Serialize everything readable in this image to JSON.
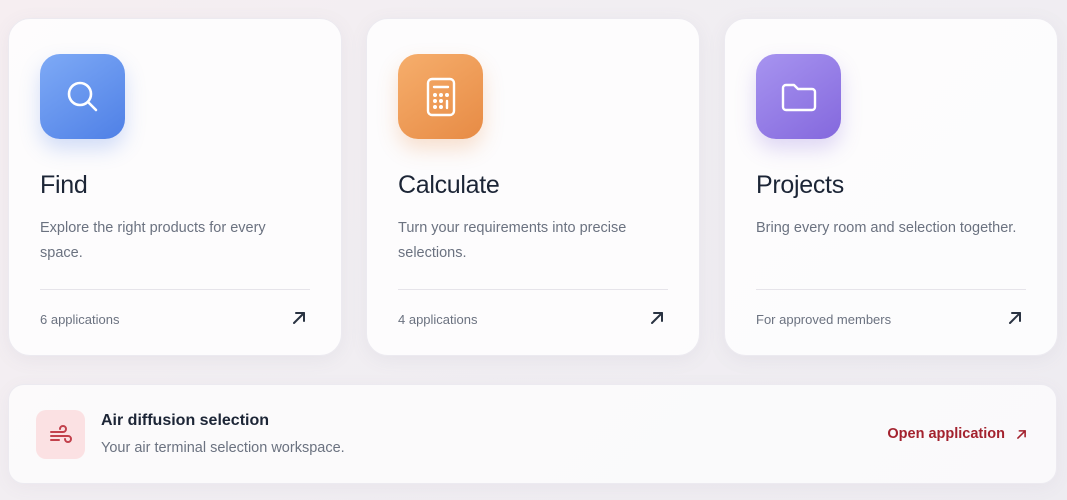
{
  "cards": [
    {
      "title": "Find",
      "description": "Explore the right products for every space.",
      "meta": "6 applications",
      "icon": "search-icon",
      "color": "#5b8cec"
    },
    {
      "title": "Calculate",
      "description": "Turn your requirements into precise selections.",
      "meta": "4 applications",
      "icon": "calculator-icon",
      "color": "#ec9a55"
    },
    {
      "title": "Projects",
      "description": "Bring every room and selection together.",
      "meta": "For approved members",
      "icon": "folder-icon",
      "color": "#8f77e4"
    }
  ],
  "banner": {
    "title": "Air diffusion selection",
    "subtitle": "Your air terminal selection workspace.",
    "link_label": "Open application",
    "icon": "wind-icon",
    "accent": "#a3222e"
  }
}
